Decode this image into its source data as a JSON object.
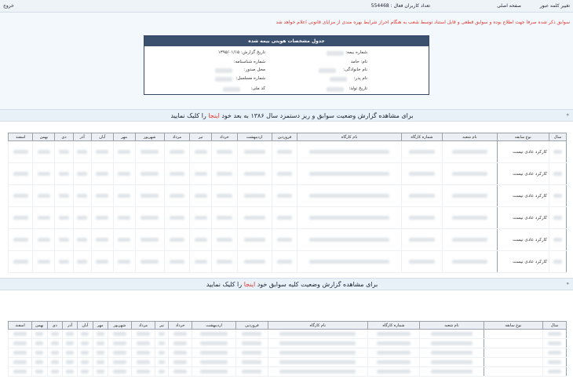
{
  "topbar": {
    "change_password": "تغییر کلمه عبور",
    "home": "صفحه اصلی",
    "active_users": "تعداد کاربران فعال : 554468",
    "logout": "خروج"
  },
  "notice": "سوابق ذکر شده صرفا جهت اطلاع بوده و سوابق قطعی و قابل استناد توسط شعب به هنگام احراز شرایط بهره مندی از مزایای قانونی اعلام خواهد شد",
  "id_card": {
    "title": "جدول مشخصات هویتی بیمه شده",
    "insurance_number_label": "شماره بیمه:",
    "name_label": "نام: حامد",
    "family_label": "نام خانوادگی:",
    "father_label": "نام پدر:",
    "birth_label": "تاریخ تولد:",
    "report_date_label": "تاریخ گزارش: ۱۳۹۵/۰۱/۱۵",
    "id_number_label": "شماره شناسنامه:",
    "issue_place_label": "محل صدور:",
    "serial_label": "شماره مسلسل:",
    "national_code_label": "کد ملی:"
  },
  "section1": {
    "prefix": "برای مشاهده گزارش وضعیت سوابق و ریز دستمزد سال ۱۳۸۶ به بعد خود",
    "link": "اینجا",
    "suffix": "را کلیک نمایید",
    "marker": "«"
  },
  "section2": {
    "prefix": "برای مشاهده گزارش وضعیت کلیه سوابق خود",
    "link": "اینجا",
    "suffix": "را کلیک نمایید",
    "marker": "«"
  },
  "table_headers": [
    "سال",
    "نوع سابقه",
    "نام شعبه",
    "شماره کارگاه",
    "نام کارگاه",
    "فروردین",
    "اردیبهشت",
    "خرداد",
    "تیر",
    "مرداد",
    "شهریور",
    "مهر",
    "آبان",
    "آذر",
    "دی",
    "بهمن",
    "اسفند"
  ],
  "table1_rows": [
    "کارکرد عادی نیست",
    "کارکرد عادی نیست",
    "کارکرد عادی نیست",
    "کارکرد عادی نیست",
    "کارکرد عادی نیست",
    "کارکرد عادی نیست"
  ],
  "table2_rows": [
    "",
    "",
    "",
    "",
    ""
  ]
}
